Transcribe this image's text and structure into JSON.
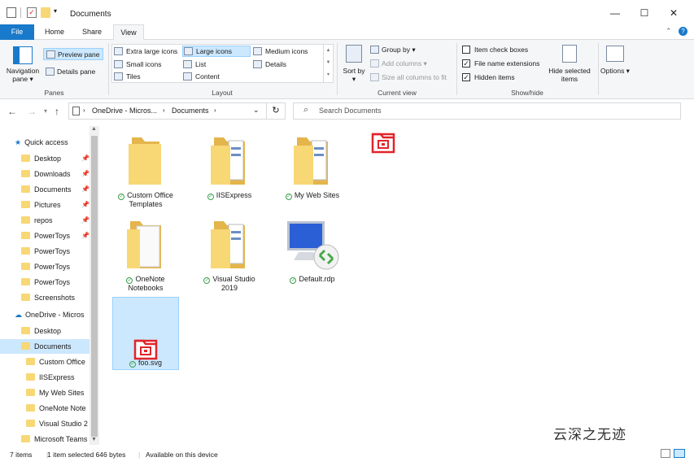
{
  "window": {
    "title": "Documents",
    "minimize_glyph": "—",
    "maximize_glyph": "☐",
    "close_glyph": "✕"
  },
  "tabs": {
    "file": "File",
    "home": "Home",
    "share": "Share",
    "view": "View"
  },
  "ribbon": {
    "panes": {
      "title": "Panes",
      "navigation_pane": "Navigation pane ▾",
      "preview_pane": "Preview pane",
      "details_pane": "Details pane"
    },
    "layout": {
      "title": "Layout",
      "extra_large_icons": "Extra large icons",
      "large_icons": "Large icons",
      "medium_icons": "Medium icons",
      "small_icons": "Small icons",
      "list": "List",
      "details": "Details",
      "tiles": "Tiles",
      "content": "Content"
    },
    "current_view": {
      "title": "Current view",
      "sort_by": "Sort by ▾",
      "group_by": "Group by ▾",
      "add_columns": "Add columns ▾",
      "size_all_columns": "Size all columns to fit"
    },
    "show_hide": {
      "title": "Show/hide",
      "item_check_boxes": "Item check boxes",
      "file_name_extensions": "File name extensions",
      "hidden_items": "Hidden items",
      "hide_selected_items": "Hide selected items",
      "checks": {
        "item_check_boxes": false,
        "file_name_extensions": true,
        "hidden_items": true
      }
    },
    "options": "Options ▾"
  },
  "address": {
    "path": [
      "OneDrive - Micros...",
      "Documents"
    ],
    "search_placeholder": "Search Documents"
  },
  "nav": {
    "quick_access": "Quick access",
    "items": [
      {
        "label": "Desktop",
        "pinned": true
      },
      {
        "label": "Downloads",
        "pinned": true
      },
      {
        "label": "Documents",
        "pinned": true
      },
      {
        "label": "Pictures",
        "pinned": true
      },
      {
        "label": "repos",
        "pinned": true
      },
      {
        "label": "PowerToys",
        "pinned": true
      },
      {
        "label": "PowerToys",
        "pinned": false
      },
      {
        "label": "PowerToys",
        "pinned": false
      },
      {
        "label": "PowerToys",
        "pinned": false
      },
      {
        "label": "Screenshots",
        "pinned": false
      }
    ],
    "onedrive": "OneDrive - Micros",
    "onedrive_items": [
      {
        "label": "Desktop"
      },
      {
        "label": "Documents"
      },
      {
        "label": "Custom Office"
      },
      {
        "label": "IISExpress"
      },
      {
        "label": "My Web Sites"
      },
      {
        "label": "OneNote Note"
      },
      {
        "label": "Visual Studio 2"
      },
      {
        "label": "Microsoft Teams"
      }
    ]
  },
  "files": [
    {
      "name": "Custom Office Templates",
      "type": "folder"
    },
    {
      "name": "IISExpress",
      "type": "folder-docs"
    },
    {
      "name": "My Web Sites",
      "type": "folder-docs"
    },
    {
      "name": "OneNote Notebooks",
      "type": "folder-white"
    },
    {
      "name": "Visual Studio 2019",
      "type": "folder-docs"
    },
    {
      "name": "Default.rdp",
      "type": "rdp"
    },
    {
      "name": "foo.svg",
      "type": "svg"
    }
  ],
  "status": {
    "item_count": "7 items",
    "selected": "1 item selected  646 bytes",
    "availability": "Available on this device"
  },
  "watermark": "云深之无迹",
  "colors": {
    "accent": "#1979ca",
    "selection": "#cce8ff",
    "folder": "#f8d775",
    "sync_ok": "#37a04a",
    "svg_icon": "#e0242a"
  }
}
